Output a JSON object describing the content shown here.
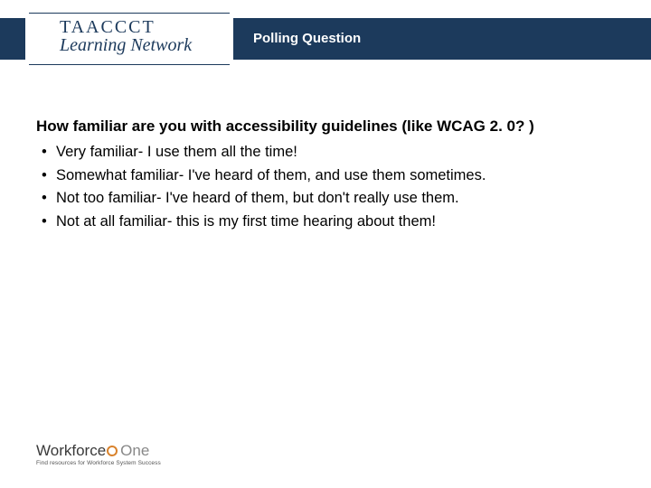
{
  "header": {
    "logo_line1": "TAACCCT",
    "logo_line2": "Learning Network",
    "title": "Polling Question"
  },
  "content": {
    "question": "How familiar are you with accessibility guidelines (like WCAG 2. 0? )",
    "options": [
      "Very familiar- I use them all the time!",
      "Somewhat familiar- I've heard of them, and use them sometimes.",
      "Not too familiar- I've heard of them, but don't really use them.",
      "Not at all familiar- this is my first time hearing about them!"
    ]
  },
  "footer": {
    "brand_main": "Workforce",
    "brand_suffix": "One",
    "tagline": "Find resources for Workforce System Success"
  }
}
